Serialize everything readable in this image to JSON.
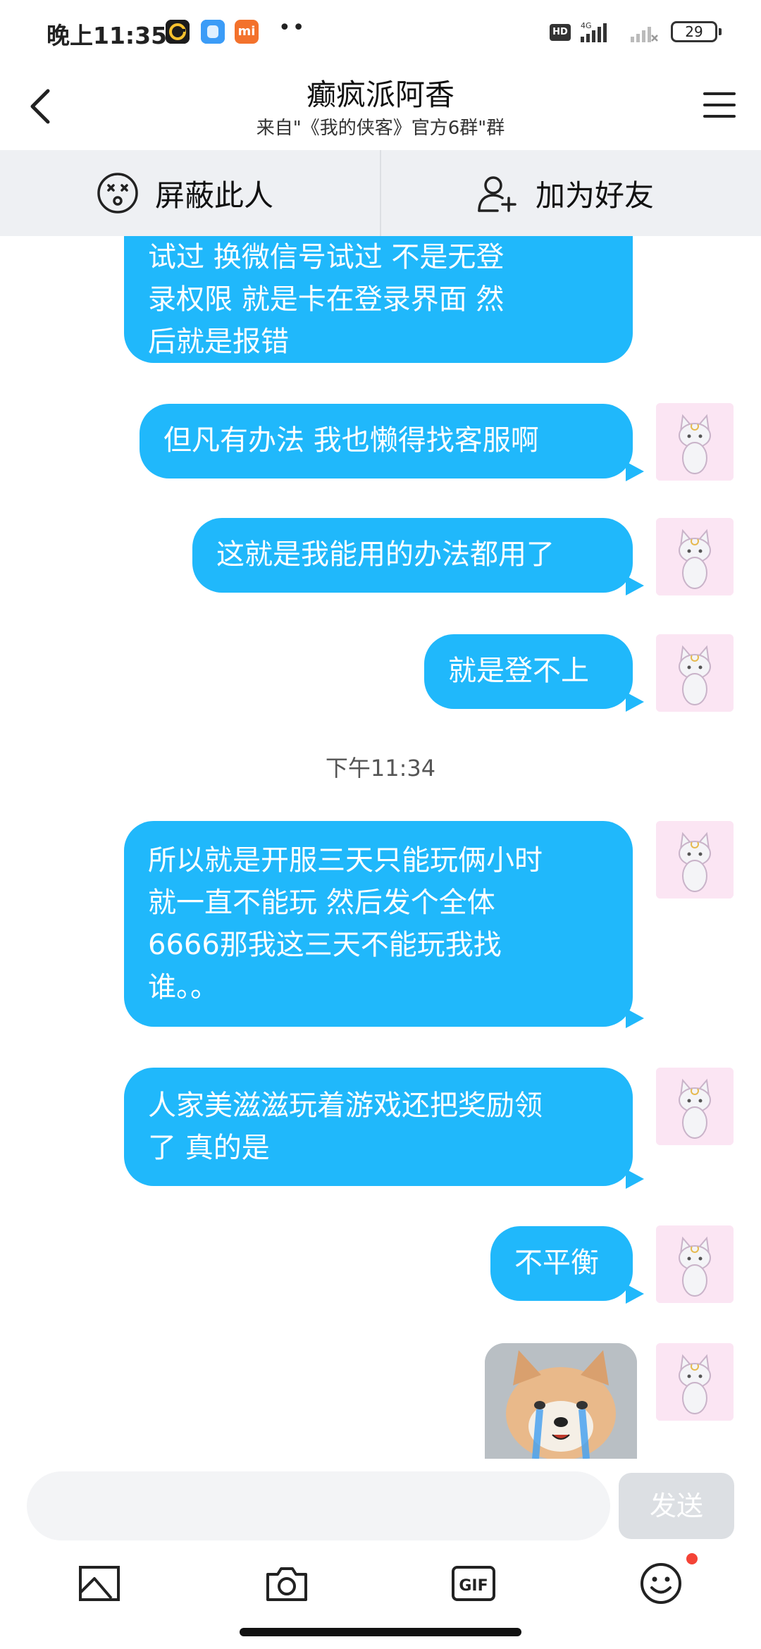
{
  "status_bar": {
    "time": "晚上11:35",
    "hd": "HD",
    "network": "4G",
    "battery": "29",
    "dots": "••",
    "mi_label": "mi"
  },
  "header": {
    "title": "癫疯派阿香",
    "subtitle": "来自\"《我的侠客》官方6群\"群"
  },
  "actions": {
    "block_label": "屏蔽此人",
    "add_friend_label": "加为好友"
  },
  "messages": [
    {
      "lines": [
        "试过  换微信号试过  不是无登",
        "录权限  就是卡在登录界面  然",
        "后就是报错"
      ]
    },
    {
      "lines": [
        "但凡有办法  我也懒得找客服啊"
      ]
    },
    {
      "lines": [
        "这就是我能用的办法都用了"
      ]
    },
    {
      "lines": [
        "就是登不上"
      ]
    },
    {
      "lines": [
        "所以就是开服三天只能玩俩小时",
        "就一直不能玩  然后发个全体",
        "6666那我这三天不能玩我找",
        "谁。。"
      ]
    },
    {
      "lines": [
        "人家美滋滋玩着游戏还把奖励领",
        "了  真的是"
      ]
    },
    {
      "lines": [
        "不平衡"
      ]
    }
  ],
  "timestamp": "下午11:34",
  "input": {
    "placeholder": "",
    "send_label": "发送"
  },
  "toolbar": {
    "icons": [
      "image-icon",
      "camera-icon",
      "gif-icon",
      "emoji-icon"
    ],
    "gif_label": "GIF"
  },
  "colors": {
    "bubble": "#20b8fb",
    "avatar_bg": "#fbe5f3",
    "action_bar_bg": "#eef0f3"
  }
}
